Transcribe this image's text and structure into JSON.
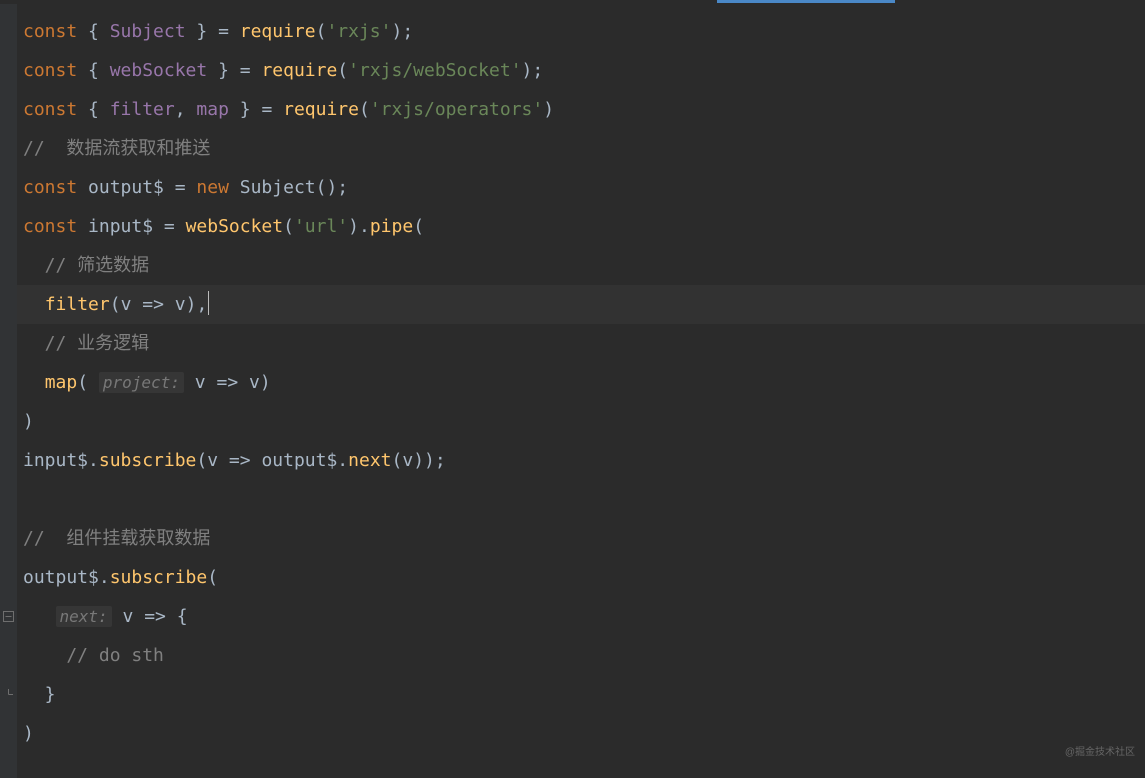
{
  "code": {
    "lines": [
      {
        "tokens": [
          {
            "cls": "kw",
            "t": "const"
          },
          {
            "cls": "punct",
            "t": " { "
          },
          {
            "cls": "def",
            "t": "Subject"
          },
          {
            "cls": "punct",
            "t": " } = "
          },
          {
            "cls": "fn",
            "t": "require"
          },
          {
            "cls": "punct",
            "t": "("
          },
          {
            "cls": "str",
            "t": "'rxjs'"
          },
          {
            "cls": "punct",
            "t": ");"
          }
        ]
      },
      {
        "tokens": [
          {
            "cls": "kw",
            "t": "const"
          },
          {
            "cls": "punct",
            "t": " { "
          },
          {
            "cls": "def",
            "t": "webSocket"
          },
          {
            "cls": "punct",
            "t": " } = "
          },
          {
            "cls": "fn",
            "t": "require"
          },
          {
            "cls": "punct",
            "t": "("
          },
          {
            "cls": "str",
            "t": "'rxjs/webSocket'"
          },
          {
            "cls": "punct",
            "t": ");"
          }
        ]
      },
      {
        "tokens": [
          {
            "cls": "kw",
            "t": "const"
          },
          {
            "cls": "punct",
            "t": " { "
          },
          {
            "cls": "def",
            "t": "filter"
          },
          {
            "cls": "punct",
            "t": ", "
          },
          {
            "cls": "def",
            "t": "map"
          },
          {
            "cls": "punct",
            "t": " } = "
          },
          {
            "cls": "fn",
            "t": "require"
          },
          {
            "cls": "punct",
            "t": "("
          },
          {
            "cls": "str",
            "t": "'rxjs/operators'"
          },
          {
            "cls": "punct",
            "t": ")"
          }
        ]
      },
      {
        "tokens": [
          {
            "cls": "comment",
            "t": "//  数据流获取和推送"
          }
        ]
      },
      {
        "tokens": [
          {
            "cls": "kw",
            "t": "const"
          },
          {
            "cls": "ident",
            "t": " output$ = "
          },
          {
            "cls": "kw",
            "t": "new"
          },
          {
            "cls": "ident",
            "t": " Subject();"
          }
        ]
      },
      {
        "tokens": [
          {
            "cls": "kw",
            "t": "const"
          },
          {
            "cls": "ident",
            "t": " input$ = "
          },
          {
            "cls": "fn",
            "t": "webSocket"
          },
          {
            "cls": "punct",
            "t": "("
          },
          {
            "cls": "str",
            "t": "'url'"
          },
          {
            "cls": "punct",
            "t": ")."
          },
          {
            "cls": "fn",
            "t": "pipe"
          },
          {
            "cls": "punct",
            "t": "("
          }
        ]
      },
      {
        "tokens": [
          {
            "cls": "comment",
            "t": "  // 筛选数据"
          }
        ]
      },
      {
        "highlighted": true,
        "cursor": true,
        "tokens": [
          {
            "cls": "ident",
            "t": "  "
          },
          {
            "cls": "fn",
            "t": "filter"
          },
          {
            "cls": "punct",
            "t": "("
          },
          {
            "cls": "ident",
            "t": "v"
          },
          {
            "cls": "punct",
            "t": " => "
          },
          {
            "cls": "ident",
            "t": "v"
          },
          {
            "cls": "punct",
            "t": "),"
          }
        ]
      },
      {
        "tokens": [
          {
            "cls": "comment",
            "t": "  // 业务逻辑"
          }
        ]
      },
      {
        "tokens": [
          {
            "cls": "ident",
            "t": "  "
          },
          {
            "cls": "fn",
            "t": "map"
          },
          {
            "cls": "punct",
            "t": "( "
          },
          {
            "cls": "hint",
            "t": "project:"
          },
          {
            "cls": "ident",
            "t": " v"
          },
          {
            "cls": "punct",
            "t": " => "
          },
          {
            "cls": "ident",
            "t": "v"
          },
          {
            "cls": "punct",
            "t": ")"
          }
        ]
      },
      {
        "tokens": [
          {
            "cls": "punct",
            "t": ")"
          }
        ]
      },
      {
        "tokens": [
          {
            "cls": "ident",
            "t": "input$."
          },
          {
            "cls": "fn",
            "t": "subscribe"
          },
          {
            "cls": "punct",
            "t": "("
          },
          {
            "cls": "ident",
            "t": "v"
          },
          {
            "cls": "punct",
            "t": " => "
          },
          {
            "cls": "ident",
            "t": "output$."
          },
          {
            "cls": "fn",
            "t": "next"
          },
          {
            "cls": "punct",
            "t": "("
          },
          {
            "cls": "ident",
            "t": "v"
          },
          {
            "cls": "punct",
            "t": "));"
          }
        ]
      },
      {
        "tokens": []
      },
      {
        "tokens": [
          {
            "cls": "comment",
            "t": "//  组件挂载获取数据"
          }
        ]
      },
      {
        "tokens": [
          {
            "cls": "ident",
            "t": "output$."
          },
          {
            "cls": "fn",
            "t": "subscribe"
          },
          {
            "cls": "punct",
            "t": "("
          }
        ]
      },
      {
        "fold": "minus",
        "tokens": [
          {
            "cls": "ident",
            "t": "   "
          },
          {
            "cls": "hint",
            "t": "next:"
          },
          {
            "cls": "ident",
            "t": " "
          },
          {
            "cls": "ident",
            "t": "v"
          },
          {
            "cls": "punct",
            "t": " => {"
          }
        ]
      },
      {
        "tokens": [
          {
            "cls": "comment",
            "t": "    // do sth"
          }
        ]
      },
      {
        "fold": "end",
        "tokens": [
          {
            "cls": "punct",
            "t": "  }"
          }
        ]
      },
      {
        "tokens": [
          {
            "cls": "punct",
            "t": ")"
          }
        ]
      }
    ]
  },
  "watermark": "@掘金技术社区"
}
